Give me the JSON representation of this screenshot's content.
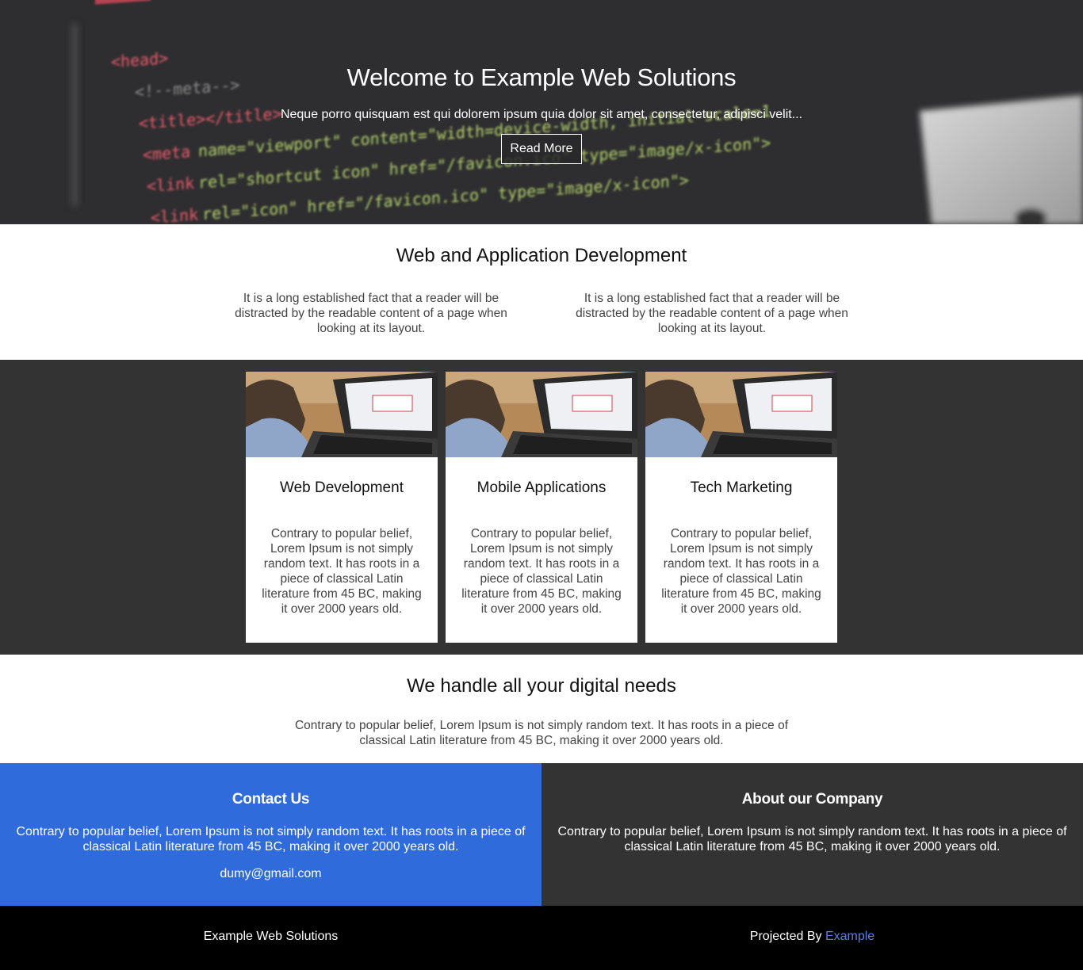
{
  "hero": {
    "title": "Welcome to Example Web Solutions",
    "subtitle": "Neque porro quisquam est qui dolorem ipsum quia dolor sit amet, consectetur, adipisci velit...",
    "button_label": "Read More"
  },
  "dev": {
    "title": "Web and Application Development",
    "columns": [
      "It is a long established fact that a reader will be distracted by the readable content of a page when looking at its layout.",
      "It is a long established fact that a reader will be distracted by the readable content of a page when looking at its layout."
    ]
  },
  "services": {
    "cards": [
      {
        "title": "Web Development",
        "text": "Contrary to popular belief, Lorem Ipsum is not simply random text. It has roots in a piece of classical Latin literature from 45 BC, making it over 2000 years old."
      },
      {
        "title": "Mobile Applications",
        "text": "Contrary to popular belief, Lorem Ipsum is not simply random text. It has roots in a piece of classical Latin literature from 45 BC, making it over 2000 years old."
      },
      {
        "title": "Tech Marketing",
        "text": "Contrary to popular belief, Lorem Ipsum is not simply random text. It has roots in a piece of classical Latin literature from 45 BC, making it over 2000 years old."
      }
    ]
  },
  "digital": {
    "title": "We handle all your digital needs",
    "text": "Contrary to popular belief, Lorem Ipsum is not simply random text. It has roots in a piece of classical Latin literature from 45 BC, making it over 2000 years old."
  },
  "contact": {
    "title": "Contact Us",
    "text": "Contrary to popular belief, Lorem Ipsum is not simply random text. It has roots in a piece of classical Latin literature from 45 BC, making it over 2000 years old.",
    "email": "dumy@gmail.com"
  },
  "about": {
    "title": "About our Company",
    "text": "Contrary to popular belief, Lorem Ipsum is not simply random text. It has roots in a piece of classical Latin literature from 45 BC, making it over 2000 years old."
  },
  "footer": {
    "brand": "Example Web Solutions",
    "projected_prefix": "Projected By ",
    "projected_link": "Example"
  },
  "colors": {
    "hero_bg": "#2e2e30",
    "dark_section": "#333333",
    "contact_blue": "#2f6bdb",
    "footer_bg": "#000000",
    "link": "#5b7fe8"
  }
}
